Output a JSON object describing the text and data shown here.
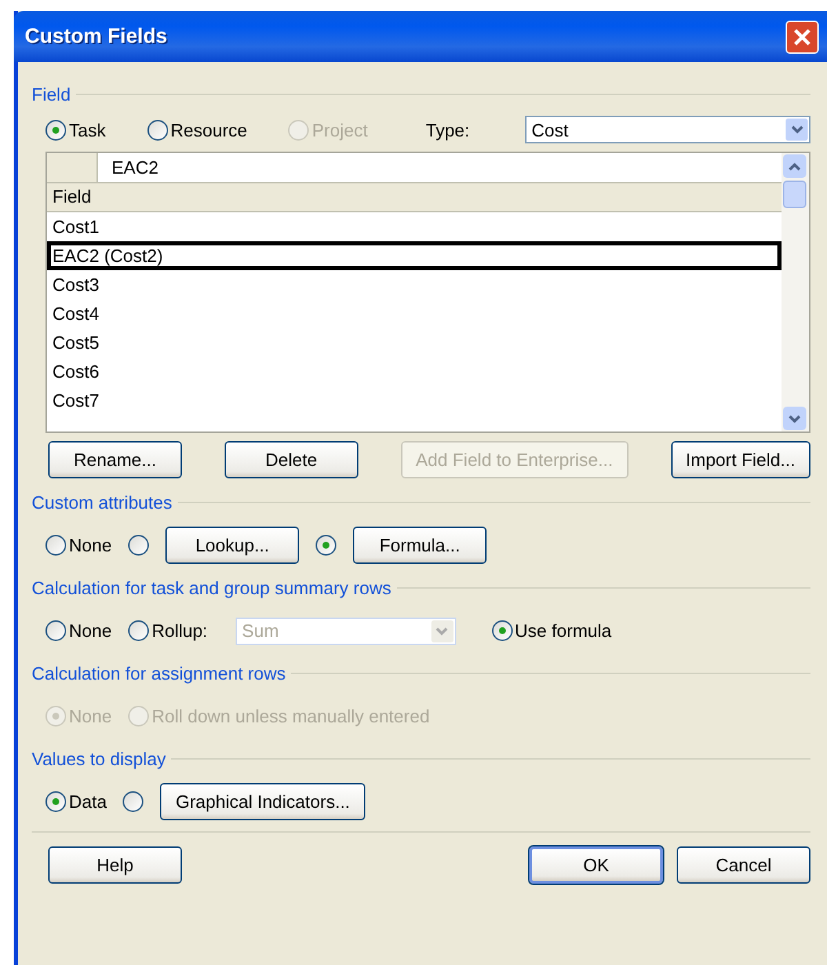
{
  "window": {
    "title": "Custom Fields"
  },
  "field_group": {
    "label": "Field",
    "scopes": [
      {
        "label": "Task",
        "selected": true,
        "disabled": false
      },
      {
        "label": "Resource",
        "selected": false,
        "disabled": false
      },
      {
        "label": "Project",
        "selected": false,
        "disabled": true
      }
    ],
    "type_label": "Type:",
    "type_value": "Cost"
  },
  "field_list": {
    "edit_value": "EAC2",
    "column": "Field",
    "rows": [
      {
        "label": "Cost1",
        "selected": false
      },
      {
        "label": "EAC2 (Cost2)",
        "selected": true
      },
      {
        "label": "Cost3",
        "selected": false
      },
      {
        "label": "Cost4",
        "selected": false
      },
      {
        "label": "Cost5",
        "selected": false
      },
      {
        "label": "Cost6",
        "selected": false
      },
      {
        "label": "Cost7",
        "selected": false
      }
    ]
  },
  "field_buttons": [
    {
      "label": "Rename...",
      "disabled": false
    },
    {
      "label": "Delete",
      "disabled": false
    },
    {
      "label": "Add Field to Enterprise...",
      "disabled": true
    },
    {
      "label": "Import Field...",
      "disabled": false
    }
  ],
  "sections": [
    {
      "label": "Custom attributes",
      "disabled": false,
      "options": [
        {
          "kind": "radio",
          "label": "None",
          "selected": false
        },
        {
          "kind": "radio-button",
          "button": "Lookup...",
          "selected": false
        },
        {
          "kind": "radio-button",
          "button": "Formula...",
          "selected": true
        }
      ]
    },
    {
      "label": "Calculation for task and group summary rows",
      "disabled": false,
      "options": [
        {
          "kind": "radio",
          "label": "None",
          "selected": false
        },
        {
          "kind": "radio-dropdown",
          "label": "Rollup:",
          "value": "Sum",
          "dropdown_disabled": true,
          "selected": false
        },
        {
          "kind": "radio",
          "label": "Use formula",
          "selected": true
        }
      ]
    },
    {
      "label": "Calculation for assignment rows",
      "disabled": true,
      "options": [
        {
          "kind": "radio",
          "label": "None",
          "selected": true
        },
        {
          "kind": "radio",
          "label": "Roll down unless manually entered",
          "selected": false
        }
      ]
    },
    {
      "label": "Values to display",
      "disabled": false,
      "options": [
        {
          "kind": "radio",
          "label": "Data",
          "selected": true
        },
        {
          "kind": "radio-button",
          "button": "Graphical Indicators...",
          "selected": false
        }
      ]
    }
  ],
  "footer_buttons": [
    {
      "label": "Help",
      "kind": "secondary"
    },
    {
      "label": "OK",
      "kind": "default"
    },
    {
      "label": "Cancel",
      "kind": "secondary"
    }
  ]
}
